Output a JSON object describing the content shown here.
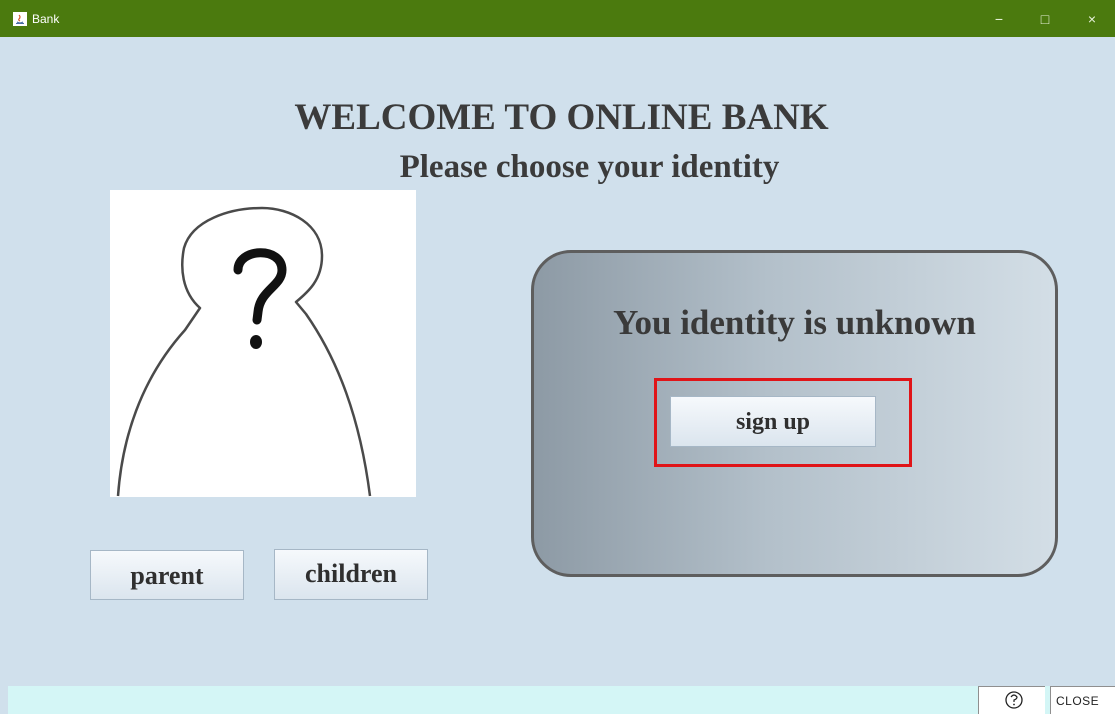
{
  "window": {
    "title": "Bank",
    "controls": {
      "minimize": "−",
      "maximize": "□",
      "close": "×"
    },
    "title_bar_color": "#4b7a0e",
    "background_color": "#d0e0ec"
  },
  "main": {
    "headline": "WELCOME TO ONLINE BANK",
    "subheadline": "Please choose your identity",
    "avatar_icon": "unknown-person-icon",
    "identity_buttons": {
      "parent": "parent",
      "children": "children"
    }
  },
  "identity_panel": {
    "status_text": "You identity is unknown",
    "signup_button": "sign up",
    "highlight_color": "#e01418"
  },
  "footer": {
    "help_icon": "help-icon",
    "close_label": "CLOSE"
  }
}
